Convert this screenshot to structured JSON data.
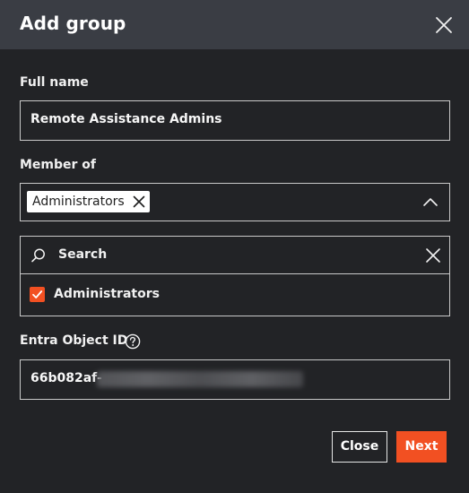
{
  "dialog": {
    "title": "Add group",
    "close_icon": "close-icon"
  },
  "full_name": {
    "label": "Full name",
    "value": "Remote Assistance Admins"
  },
  "member_of": {
    "label": "Member of",
    "selected_chips": [
      "Administrators"
    ],
    "expanded": true,
    "search": {
      "placeholder": "Search",
      "icon": "search-icon",
      "clear_icon": "close-icon"
    },
    "options": [
      {
        "label": "Administrators",
        "checked": true
      }
    ]
  },
  "entra_object_id": {
    "label": "Entra Object ID",
    "help_icon": "help-circle-icon",
    "value_visible": "66b082af-",
    "value_redacted": true
  },
  "footer": {
    "close_label": "Close",
    "next_label": "Next"
  },
  "colors": {
    "accent": "#f25022",
    "header_bg": "#3a3d44",
    "body_bg": "#222326",
    "border": "#c9c9c9"
  }
}
